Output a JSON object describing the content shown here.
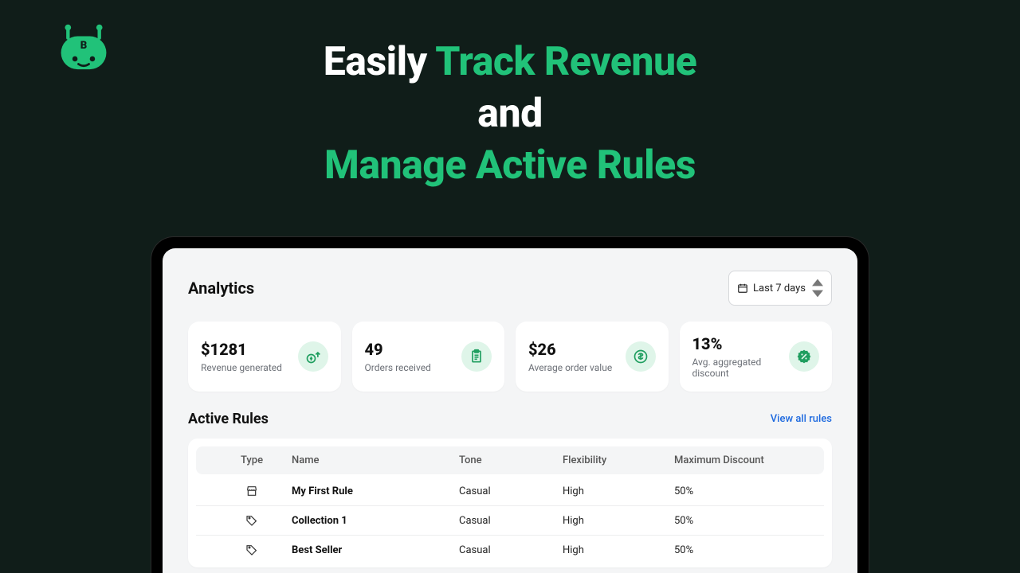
{
  "hero": {
    "part1": "Easily ",
    "part2": "Track Revenue",
    "part3": "and",
    "part4": "Manage Active Rules"
  },
  "analytics": {
    "title": "Analytics",
    "dateRange": "Last 7 days"
  },
  "cards": [
    {
      "value": "$1281",
      "label": "Revenue generated"
    },
    {
      "value": "49",
      "label": "Orders received"
    },
    {
      "value": "$26",
      "label": "Average order value"
    },
    {
      "value": "13%",
      "label": "Avg. aggregated discount"
    }
  ],
  "rules": {
    "title": "Active Rules",
    "viewAll": "View all rules",
    "columns": {
      "type": "Type",
      "name": "Name",
      "tone": "Tone",
      "flex": "Flexibility",
      "max": "Maximum Discount"
    },
    "rows": [
      {
        "icon": "store",
        "name": "My First Rule",
        "tone": "Casual",
        "flex": "High",
        "max": "50%"
      },
      {
        "icon": "tag",
        "name": "Collection 1",
        "tone": "Casual",
        "flex": "High",
        "max": "50%"
      },
      {
        "icon": "tag",
        "name": "Best Seller",
        "tone": "Casual",
        "flex": "High",
        "max": "50%"
      }
    ]
  }
}
